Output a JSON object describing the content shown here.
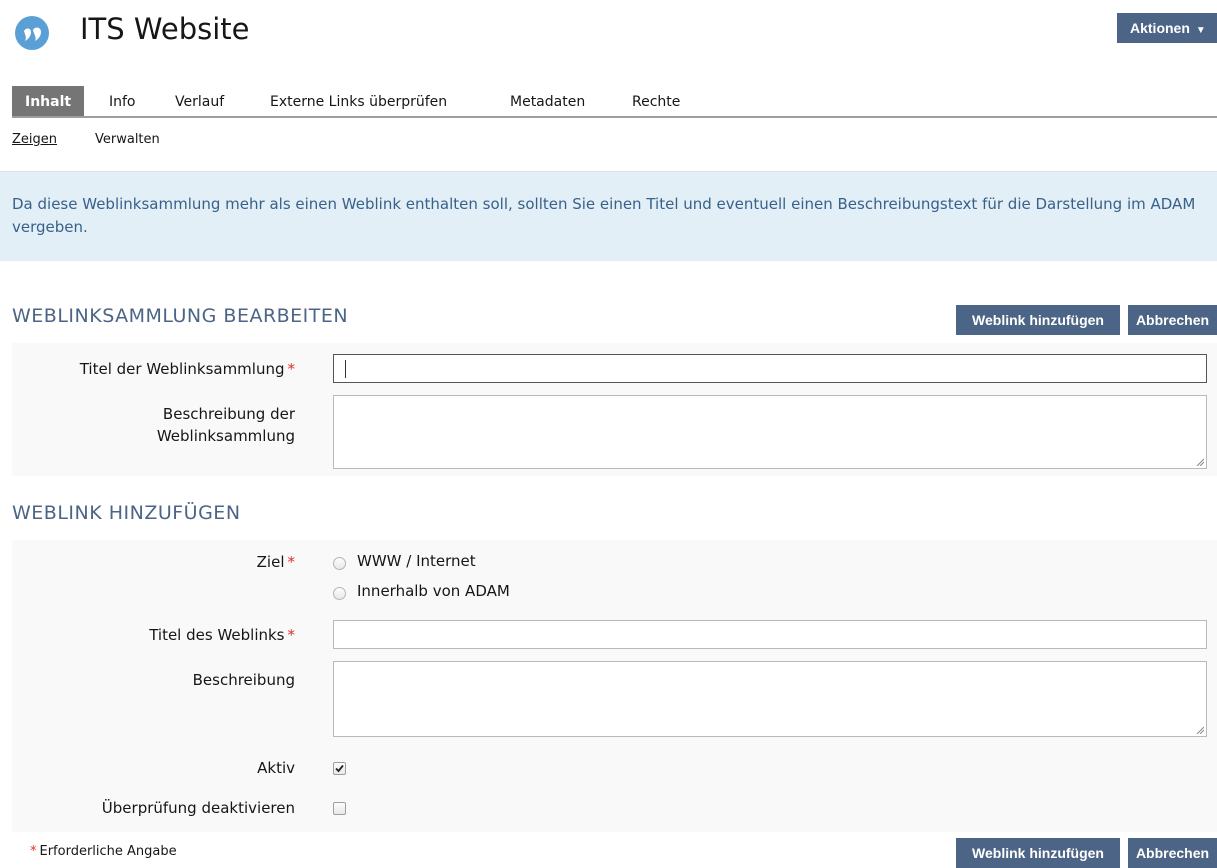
{
  "header": {
    "title": "ITS Website",
    "actions_label": "Aktionen"
  },
  "tabs": [
    {
      "label": "Inhalt",
      "active": true
    },
    {
      "label": "Info"
    },
    {
      "label": "Verlauf"
    },
    {
      "label": "Externe Links überprüfen"
    },
    {
      "label": "Metadaten"
    },
    {
      "label": "Rechte"
    }
  ],
  "subtabs": [
    {
      "label": "Zeigen",
      "active": true
    },
    {
      "label": "Verwalten"
    }
  ],
  "info_message": "Da diese Weblinksammlung mehr als einen Weblink enthalten soll, sollten Sie einen Titel und eventuell einen Beschreibungstext für die Darstellung im ADAM vergeben.",
  "section_edit": {
    "title": "WEBLINKSAMMLUNG BEARBEITEN",
    "title_label": "Titel der Weblinksammlung",
    "title_value": "",
    "desc_label": "Beschreibung der Weblinksammlung",
    "desc_value": ""
  },
  "section_add": {
    "title": "WEBLINK HINZUFÜGEN",
    "target_label": "Ziel",
    "target_options": [
      "WWW / Internet",
      "Innerhalb von ADAM"
    ],
    "link_title_label": "Titel des Weblinks",
    "link_title_value": "",
    "desc_label": "Beschreibung",
    "desc_value": "",
    "active_label": "Aktiv",
    "active_checked": true,
    "disable_check_label": "Überprüfung deaktivieren",
    "disable_check_checked": false
  },
  "buttons": {
    "add_weblink": "Weblink hinzufügen",
    "cancel": "Abbrechen"
  },
  "required_marker": "*",
  "footnote": "Erforderliche Angabe",
  "colors": {
    "primary_button": "#4c6586",
    "active_tab": "#757575",
    "info_bg": "#e3eff7",
    "info_text": "#38618a",
    "required": "#e02d2d",
    "logo": "#5a9fd5"
  }
}
